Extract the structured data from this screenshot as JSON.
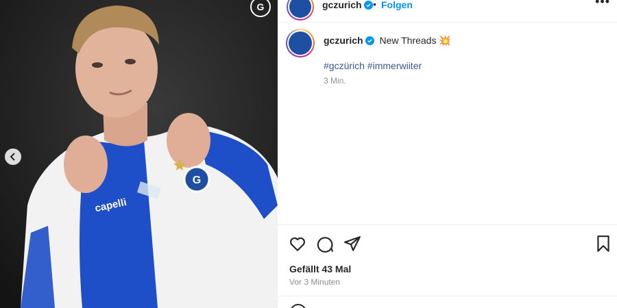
{
  "header": {
    "username": "gczurich",
    "separator": "•",
    "follow_label": "Folgen",
    "more": "•••"
  },
  "caption": {
    "username": "gczurich",
    "text": "New Threads 💥",
    "hashtags": "#gczürich #immerwiiter",
    "time": "3 Min."
  },
  "media": {
    "jersey_sponsor": "capelli",
    "carousel_prev_icon": "chevron-left-icon"
  },
  "actions": {
    "icons": [
      "heart-icon",
      "comment-icon",
      "share-icon",
      "bookmark-icon"
    ],
    "likes": "Gefällt 43 Mal",
    "posted_ago": "Vor 3 Minuten"
  },
  "colors": {
    "link_blue": "#0095f6",
    "hashtag": "#385898",
    "jersey_blue": "#1e4fc9",
    "club_blue": "#1e4fa3"
  }
}
